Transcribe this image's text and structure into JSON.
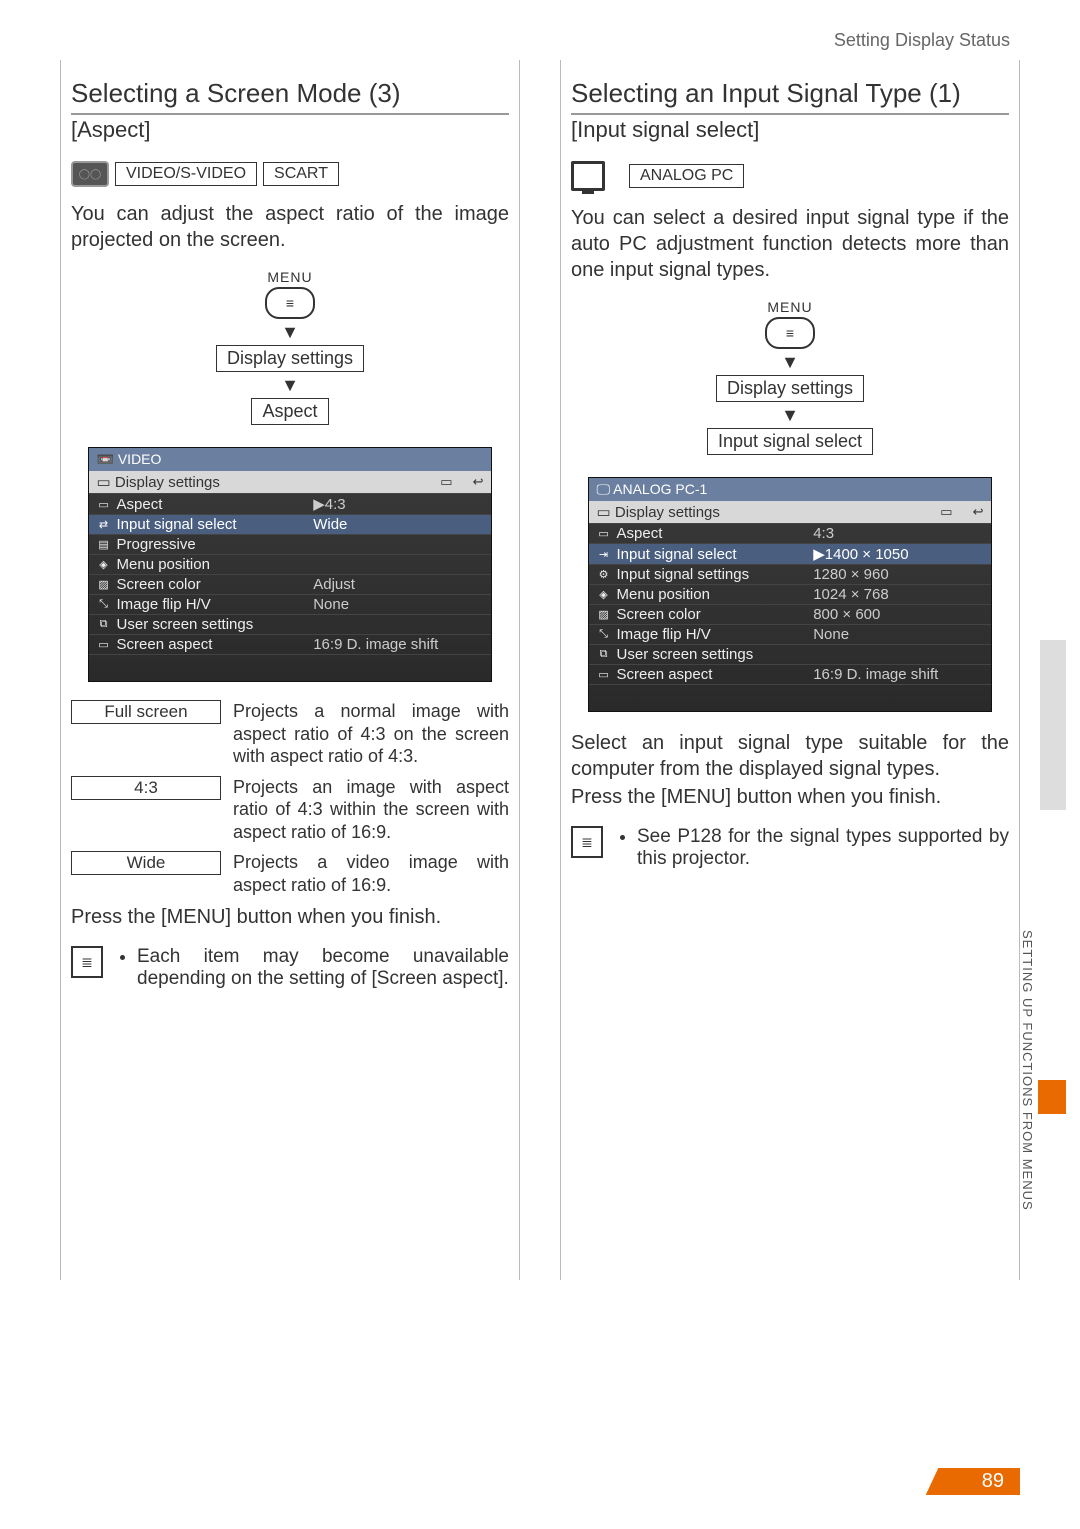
{
  "header": {
    "top_right": "Setting Display Status"
  },
  "left": {
    "title": "Selecting a Screen Mode (3)",
    "subtitle": "[Aspect]",
    "badges": [
      "VIDEO/S-VIDEO",
      "SCART"
    ],
    "intro": "You can adjust the aspect ratio of the image projected on the screen.",
    "flow": {
      "menu": "MENU",
      "step1": "Display settings",
      "step2": "Aspect"
    },
    "osd": {
      "header": "VIDEO",
      "title": "Display settings",
      "rows": [
        {
          "icon": "▭",
          "label": "Aspect",
          "value": "▶4:3",
          "hl": false
        },
        {
          "icon": "⇄",
          "label": "Input signal select",
          "value": "Wide",
          "hl": true
        },
        {
          "icon": "▤",
          "label": "Progressive",
          "value": "",
          "hl": false
        },
        {
          "icon": "◈",
          "label": "Menu position",
          "value": "",
          "hl": false
        },
        {
          "icon": "▨",
          "label": "Screen color",
          "value": "Adjust",
          "hl": false
        },
        {
          "icon": "⤡",
          "label": "Image flip H/V",
          "value": "None",
          "hl": false
        },
        {
          "icon": "⧉",
          "label": "User screen settings",
          "value": "",
          "hl": false
        },
        {
          "icon": "▭",
          "label": "Screen aspect",
          "value": "16:9 D. image shift",
          "hl": false
        }
      ]
    },
    "options": [
      {
        "key": "Full screen",
        "desc": "Projects a normal image with aspect ratio of 4:3 on the screen with aspect ratio of 4:3."
      },
      {
        "key": "4:3",
        "desc": "Projects an image with aspect ratio of 4:3 within the screen with aspect ratio of 16:9."
      },
      {
        "key": "Wide",
        "desc": "Projects a video image with aspect ratio of 16:9."
      }
    ],
    "finish": "Press the [MENU] button when you finish.",
    "note": "Each item may become unavailable depending on the setting of [Screen aspect]."
  },
  "right": {
    "title": "Selecting an Input Signal Type (1)",
    "subtitle": "[Input signal select]",
    "badges": [
      "ANALOG PC"
    ],
    "intro": "You can select a desired input signal type if the auto PC adjustment function detects more than one input signal types.",
    "flow": {
      "menu": "MENU",
      "step1": "Display settings",
      "step2": "Input signal select"
    },
    "osd": {
      "header": "ANALOG PC-1",
      "title": "Display settings",
      "rows": [
        {
          "icon": "▭",
          "label": "Aspect",
          "value": "4:3",
          "hl": false
        },
        {
          "icon": "⇥",
          "label": "Input signal select",
          "value": "▶1400 × 1050",
          "hl": true
        },
        {
          "icon": "⚙",
          "label": "Input signal settings",
          "value": "1280 × 960",
          "hl": false
        },
        {
          "icon": "◈",
          "label": "Menu position",
          "value": "1024 × 768",
          "hl": false
        },
        {
          "icon": "▨",
          "label": "Screen color",
          "value": "800 × 600",
          "hl": false
        },
        {
          "icon": "⤡",
          "label": "Image flip H/V",
          "value": "None",
          "hl": false
        },
        {
          "icon": "⧉",
          "label": "User screen settings",
          "value": "",
          "hl": false
        },
        {
          "icon": "▭",
          "label": "Screen aspect",
          "value": "16:9 D. image shift",
          "hl": false
        }
      ]
    },
    "after1": "Select an input signal type suitable for the computer from the displayed signal types.",
    "after2": "Press the [MENU] button when you finish.",
    "note": "See P128 for the signal types supported by this projector."
  },
  "side_text": "SETTING UP FUNCTIONS FROM MENUS",
  "page_number": "89"
}
